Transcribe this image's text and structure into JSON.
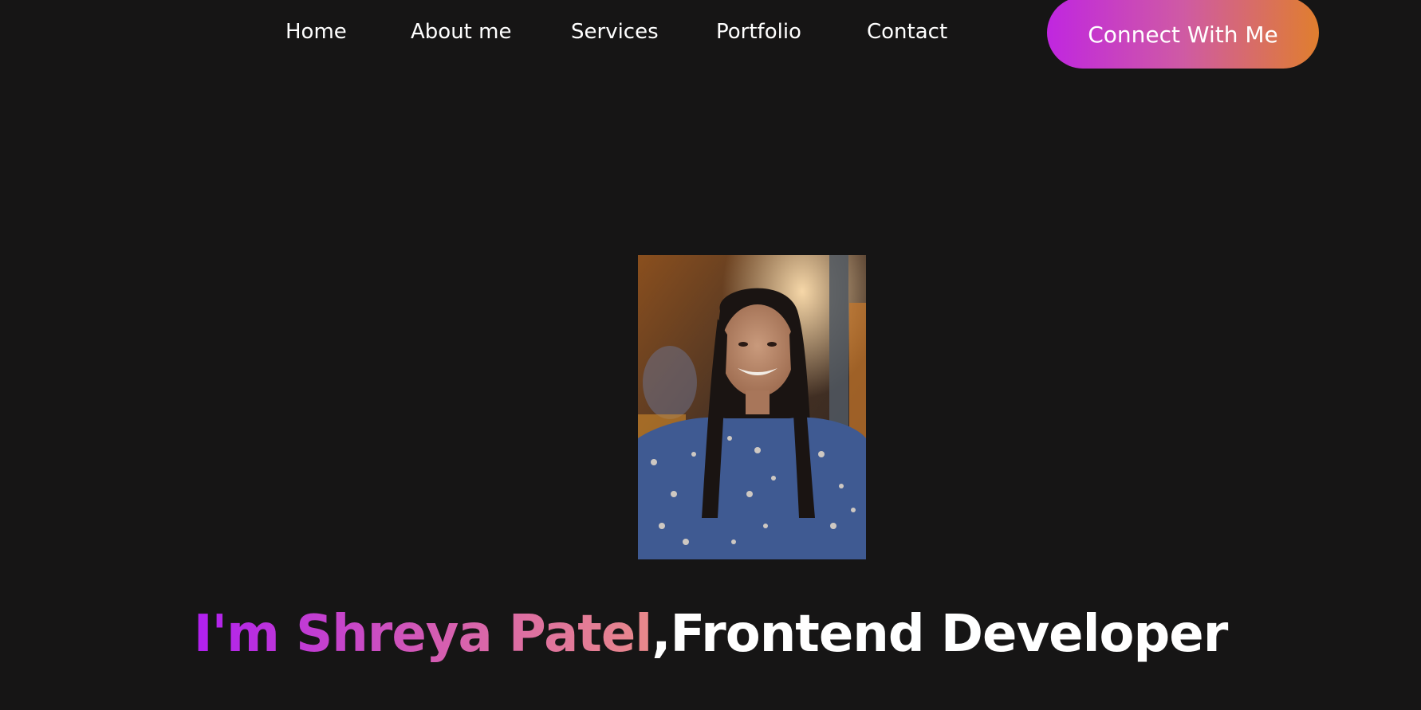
{
  "nav": {
    "items": [
      {
        "label": "Home"
      },
      {
        "label": "About me"
      },
      {
        "label": "Services"
      },
      {
        "label": "Portfolio"
      },
      {
        "label": "Contact"
      }
    ],
    "cta_label": "Connect With Me"
  },
  "hero": {
    "photo_icon": "profile-photo",
    "name_text": "I'm Shreya Patel",
    "role_text": ",Frontend Developer"
  },
  "colors": {
    "background": "#161515",
    "gradient_start": "#c026e0",
    "gradient_mid": "#cf5aa4",
    "gradient_end": "#e07e2e",
    "text": "#ffffff"
  }
}
